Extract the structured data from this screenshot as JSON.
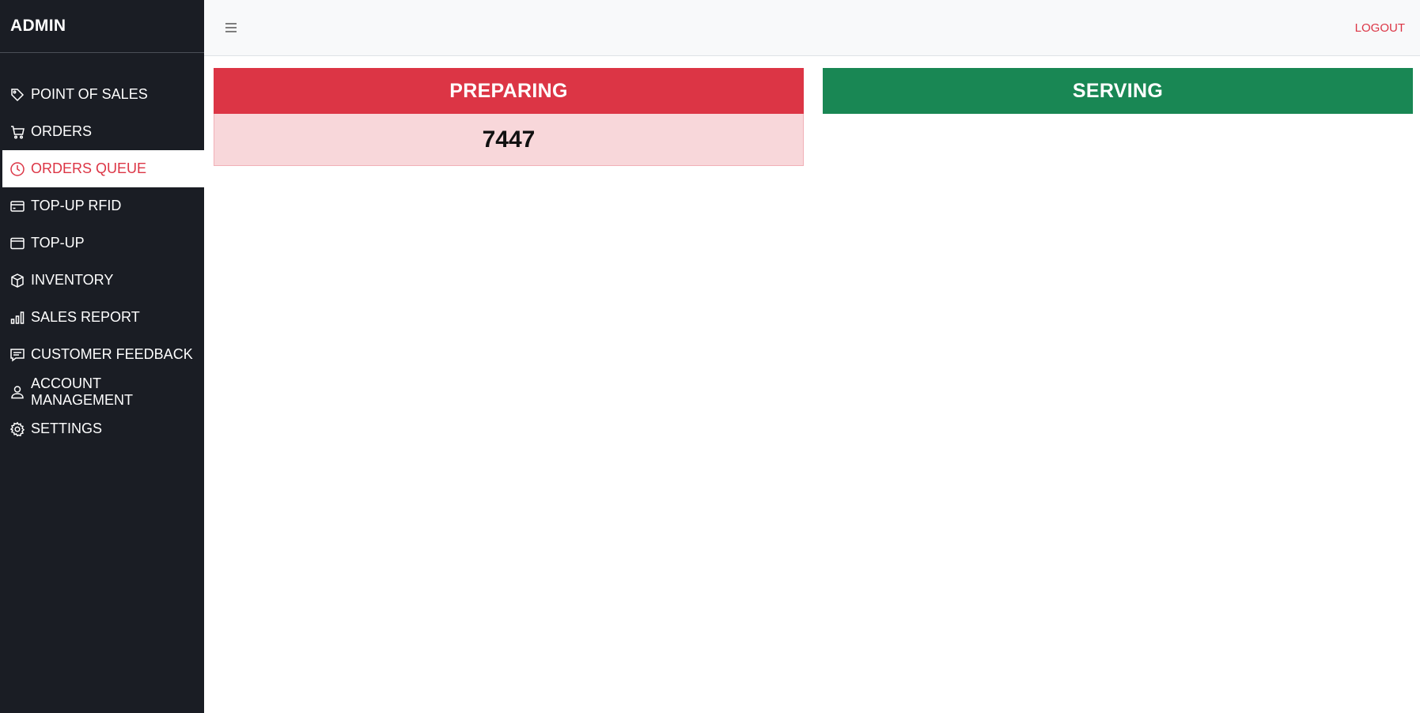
{
  "brand": "ADMIN",
  "sidebar": {
    "items": [
      {
        "label": "POINT OF SALES",
        "icon": "tag-icon"
      },
      {
        "label": "ORDERS",
        "icon": "cart-icon"
      },
      {
        "label": "ORDERS QUEUE",
        "icon": "clock-icon",
        "active": true
      },
      {
        "label": "TOP-UP RFID",
        "icon": "credit-card-icon"
      },
      {
        "label": "TOP-UP",
        "icon": "window-icon"
      },
      {
        "label": "INVENTORY",
        "icon": "box-icon"
      },
      {
        "label": "SALES REPORT",
        "icon": "bar-chart-icon"
      },
      {
        "label": "CUSTOMER FEEDBACK",
        "icon": "message-icon"
      },
      {
        "label": "ACCOUNT MANAGEMENT",
        "icon": "person-icon"
      },
      {
        "label": "SETTINGS",
        "icon": "gear-icon"
      }
    ]
  },
  "topbar": {
    "menu_icon": "hamburger-icon",
    "logout_label": "LOGOUT"
  },
  "queue": {
    "preparing": {
      "title": "PREPARING",
      "orders": [
        "7447"
      ]
    },
    "serving": {
      "title": "SERVING",
      "orders": []
    }
  },
  "colors": {
    "sidebar_bg": "#1a1d24",
    "danger": "#dc3545",
    "success": "#198754",
    "danger_light": "#f8d7da"
  }
}
